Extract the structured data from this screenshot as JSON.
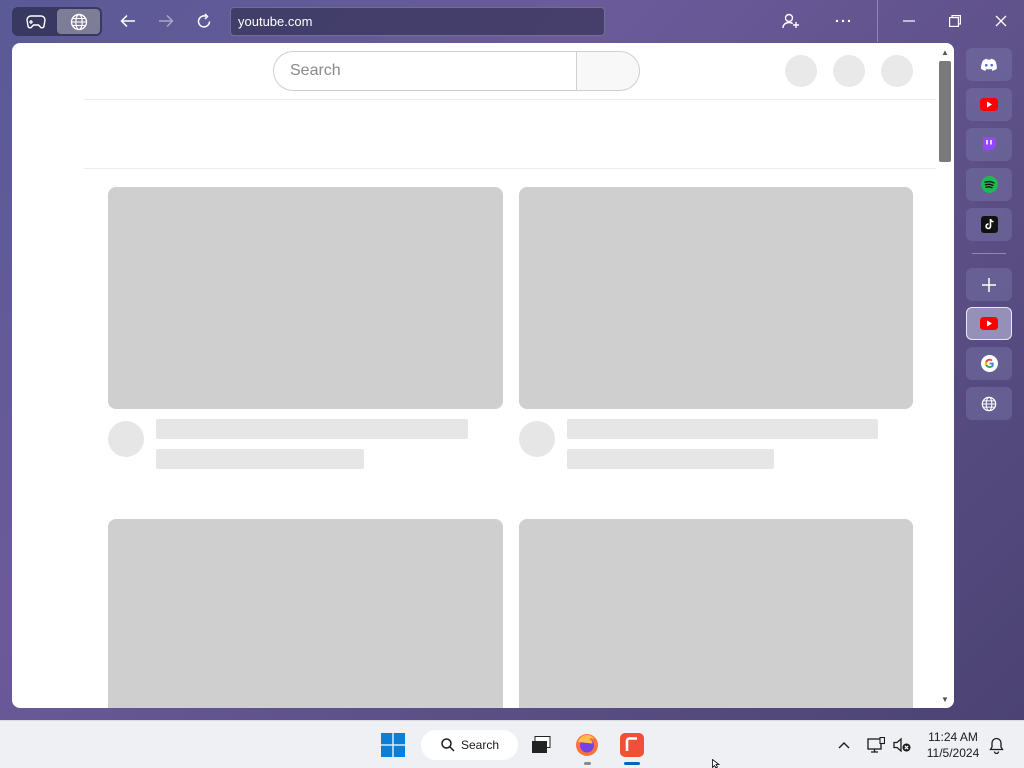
{
  "address_bar": {
    "url": "youtube.com"
  },
  "page": {
    "search_placeholder": "Search"
  },
  "dock": {
    "top_apps": [
      "discord-icon",
      "youtube-icon",
      "twitch-icon",
      "spotify-icon",
      "tiktok-icon"
    ],
    "tabs": [
      "add-icon",
      "youtube-icon",
      "google-icon",
      "globe-icon"
    ]
  },
  "taskbar": {
    "search_label": "Search",
    "time": "11:24 AM",
    "date": "11/5/2024"
  },
  "colors": {
    "youtube": "#ff0000",
    "twitch": "#9146ff",
    "spotify": "#1db954",
    "discord": "#5865f2",
    "accent": "#0067c0"
  }
}
